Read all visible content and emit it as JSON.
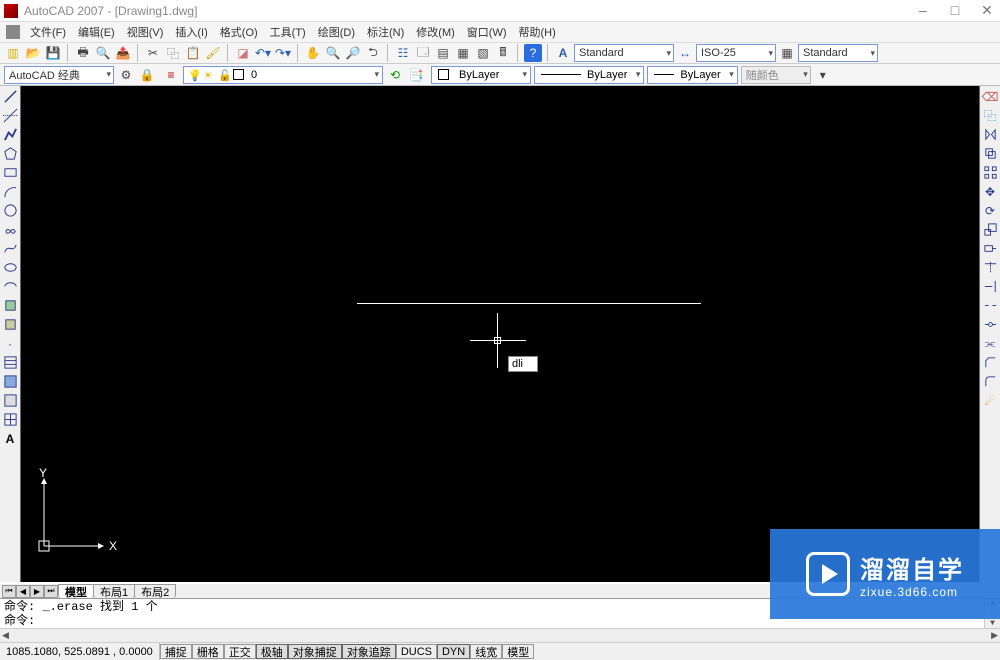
{
  "title": "AutoCAD 2007 - [Drawing1.dwg]",
  "menu": [
    "文件(F)",
    "编辑(E)",
    "视图(V)",
    "插入(I)",
    "格式(O)",
    "工具(T)",
    "绘图(D)",
    "标注(N)",
    "修改(M)",
    "窗口(W)",
    "帮助(H)"
  ],
  "text_style": "Standard",
  "dim_style": "ISO-25",
  "table_style": "Standard",
  "workspace": "AutoCAD 经典",
  "layer_current": "0",
  "color_control": "ByLayer",
  "linetype_control": "ByLayer",
  "lineweight_control": "ByLayer",
  "plotstyle_control": "随颜色",
  "dyn_input": "dli",
  "ucs_x": "X",
  "ucs_y": "Y",
  "tabs": {
    "model": "模型",
    "layout1": "布局1",
    "layout2": "布局2"
  },
  "cmd1": "命令: _.erase 找到 1 个",
  "cmd2": "命令:",
  "coords": "1085.1080, 525.0891 , 0.0000",
  "snaps": [
    "捕捉",
    "栅格",
    "正交",
    "极轴",
    "对象捕捉",
    "对象追踪",
    "DUCS",
    "DYN",
    "线宽",
    "模型"
  ],
  "watermark": {
    "big": "溜溜自学",
    "small": "zixue.3d66.com"
  }
}
